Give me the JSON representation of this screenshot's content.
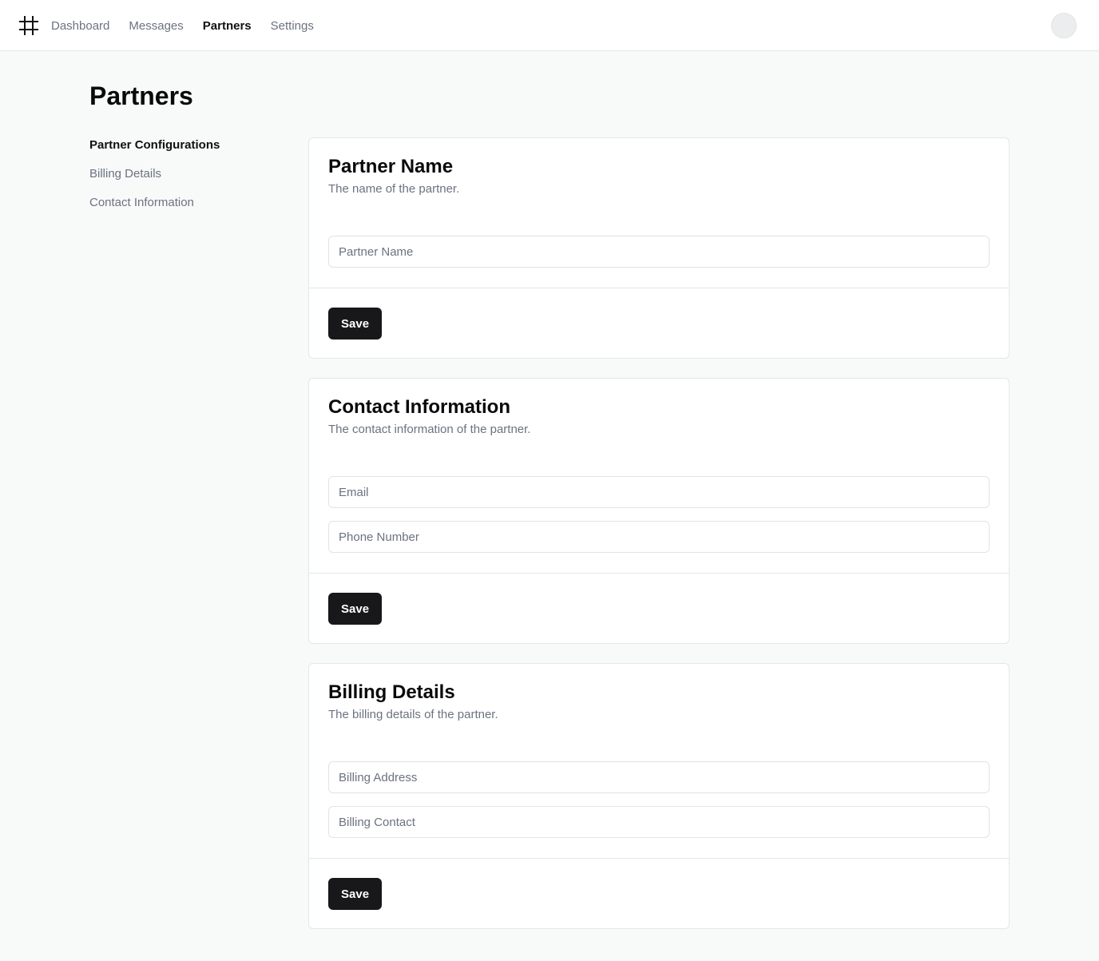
{
  "nav": {
    "items": [
      {
        "label": "Dashboard",
        "active": false
      },
      {
        "label": "Messages",
        "active": false
      },
      {
        "label": "Partners",
        "active": true
      },
      {
        "label": "Settings",
        "active": false
      }
    ]
  },
  "icons": {
    "logo": "hash-icon",
    "avatar": "user-avatar"
  },
  "page": {
    "title": "Partners"
  },
  "sidenav": {
    "items": [
      {
        "label": "Partner Configurations",
        "active": true
      },
      {
        "label": "Billing Details",
        "active": false
      },
      {
        "label": "Contact Information",
        "active": false
      }
    ]
  },
  "cards": [
    {
      "title": "Partner Name",
      "description": "The name of the partner.",
      "fields": [
        {
          "placeholder": "Partner Name",
          "value": ""
        }
      ],
      "save_label": "Save"
    },
    {
      "title": "Contact Information",
      "description": "The contact information of the partner.",
      "fields": [
        {
          "placeholder": "Email",
          "value": ""
        },
        {
          "placeholder": "Phone Number",
          "value": ""
        }
      ],
      "save_label": "Save"
    },
    {
      "title": "Billing Details",
      "description": "The billing details of the partner.",
      "fields": [
        {
          "placeholder": "Billing Address",
          "value": ""
        },
        {
          "placeholder": "Billing Contact",
          "value": ""
        }
      ],
      "save_label": "Save"
    }
  ],
  "colors": {
    "background": "#f8faf9",
    "button": "#18181b",
    "muted_text": "#6b7280"
  }
}
